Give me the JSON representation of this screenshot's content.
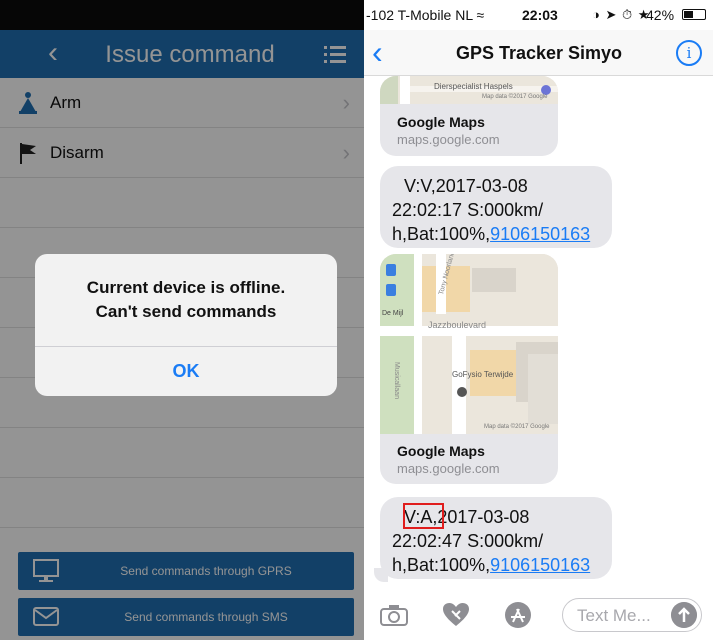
{
  "left": {
    "title": "Issue command",
    "commands": [
      {
        "label": "Arm",
        "icon": "arm-icon"
      },
      {
        "label": "Disarm",
        "icon": "flag-icon"
      }
    ],
    "alert": {
      "line1": "Current device is offline.",
      "line2": "Can't send commands",
      "ok": "OK"
    },
    "buttons": {
      "gprs": "Send commands through GPRS",
      "sms": "Send commands through SMS"
    },
    "colors": {
      "accent": "#1f6fb2"
    }
  },
  "right": {
    "status": {
      "carrier": "-102 T-Mobile NL",
      "time": "22:03",
      "battery": "42%"
    },
    "header": {
      "title": "GPS Tracker Simyo"
    },
    "messages": [
      {
        "type": "map",
        "map_labels": [
          "Dierspecialist Haspels",
          "Map data ©2017 Google"
        ],
        "source": "Google Maps",
        "url": "maps.google.com"
      },
      {
        "type": "text",
        "code": "V:V,",
        "line1": "2017-03-08",
        "line2": "22:02:17 S:000km/",
        "line3": "h,Bat:100%,",
        "phone": "9106150163"
      },
      {
        "type": "map",
        "map_labels": [
          "De Mijl",
          "Jazzboulevard",
          "Musicallaan",
          "Tony Noorlandpad",
          "GoFysio Terwijde",
          "Map data ©2017 Google"
        ],
        "source": "Google Maps",
        "url": "maps.google.com"
      },
      {
        "type": "text",
        "code": "V:A,",
        "line1": "2017-03-08",
        "line2": "22:02:47 S:000km/",
        "line3": "h,Bat:100%,",
        "phone": "9106150163"
      }
    ],
    "composer": {
      "placeholder": "Text Me..."
    },
    "colors": {
      "link": "#1a7cf5",
      "highlight": "#e01d1d"
    }
  }
}
